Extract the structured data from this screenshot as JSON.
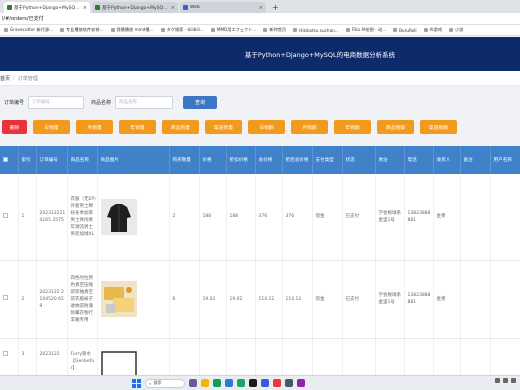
{
  "browser": {
    "tabs": [
      {
        "label": "基于Python+Django+MySQL的电商...",
        "active": true
      },
      {
        "label": "基于Python+Django+MySQL...",
        "active": false
      },
      {
        "label": "Web",
        "active": false
      }
    ],
    "url": "l/#/orders/已支付",
    "bookmarks": [
      "Gravecutter 新代源...",
      "专业播放软件安装...",
      "我最播放 mmd播...",
      "タグ検索 - bilibili...",
      "MMD用エフェクト...",
      "新特首页",
      "Hikikatsu suchan...",
      "Filia AI绘图 - 动...",
      "BoruRoll",
      "AI游戏",
      "小游"
    ]
  },
  "app": {
    "title": "基于Python+Django+MySQL的电商数据分析系统",
    "breadcrumb_home": "首页",
    "breadcrumb_current": "订单管理"
  },
  "filters": {
    "order_no_label": "订单编号",
    "order_no_placeholder": "订单编号",
    "product_label": "商品名称",
    "product_placeholder": "商品名称",
    "query_button": "查询"
  },
  "actions": {
    "delete": "删除",
    "buttons": [
      "日销量",
      "月销量",
      "年销量",
      "商品销量",
      "渠道销量",
      "日销额",
      "月销额",
      "年销额",
      "商品销额",
      "渠道销额"
    ]
  },
  "table": {
    "columns": [
      "索引",
      "订单编号",
      "商品名称",
      "商品图片",
      "购买数量",
      "价格",
      "折扣价格",
      "总价格",
      "折后总价格",
      "支付类型",
      "状态",
      "地址",
      "电话",
      "收货人",
      "备注",
      "用户名称"
    ],
    "rows": [
      {
        "index": "1",
        "order_no": "2023122214165 3575",
        "product": "衣服（无EP）外套男士棉袄冬季加厚男士休闲青年潮流男士男装加绒XL",
        "qty": "2",
        "price": "188",
        "discount_price": "188",
        "total": "376",
        "discount_total": "376",
        "pay_type": "现金",
        "status": "已支付",
        "address": "学会根球系金里1号",
        "phone": "13823888881",
        "receiver": "金莱",
        "remark": "",
        "username": ""
      },
      {
        "index": "2",
        "order_no": "2023122 2104520 659",
        "product": "四色时拉原色真空压缩袋装抽真空袋衣服被子收纳袋防潮防霉衣物行李箱专用",
        "qty": "6",
        "price": "19.02",
        "discount_price": "19.02",
        "total": "114.12",
        "discount_total": "114.12",
        "pay_type": "现金",
        "status": "已支付",
        "address": "学会根球系金里1号",
        "phone": "13823888881",
        "receiver": "金莱",
        "remark": "",
        "username": ""
      },
      {
        "index": "3",
        "order_no": "2023122",
        "product": "Furry兽水【Genbefur】",
        "qty": "",
        "price": "",
        "discount_price": "",
        "total": "",
        "discount_total": "",
        "pay_type": "",
        "status": "",
        "address": "",
        "phone": "",
        "receiver": "",
        "remark": "",
        "username": ""
      }
    ]
  },
  "taskbar": {
    "search_label": "搜索"
  },
  "colors": {
    "header_bg": "#0d2a6b",
    "table_header_bg": "#3f82c9",
    "delete_btn": "#e8333a",
    "action_btn": "#f29a1e",
    "query_btn": "#3a76c4"
  }
}
